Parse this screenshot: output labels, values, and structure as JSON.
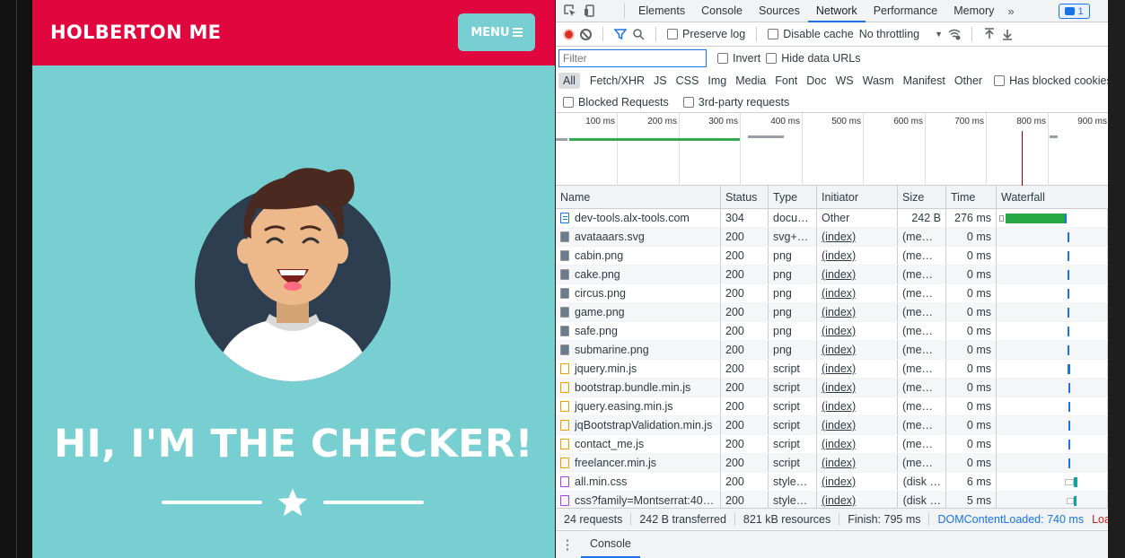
{
  "site": {
    "brand": "HOLBERTON ME",
    "menu_label": "MENU",
    "hero_title": "HI, I'M THE CHECKER!",
    "colors": {
      "nav": "#e2063f",
      "hero_bg": "#78cfd1",
      "text": "#ffffff"
    }
  },
  "devtools": {
    "tabs": [
      "Elements",
      "Console",
      "Sources",
      "Network",
      "Performance",
      "Memory"
    ],
    "active_tab": "Network",
    "more_tabs": "»",
    "issues_count": "1",
    "toolbar": {
      "preserve_log": "Preserve log",
      "disable_cache": "Disable cache",
      "throttling": "No throttling"
    },
    "filter": {
      "placeholder": "Filter",
      "invert": "Invert",
      "hide_data_urls": "Hide data URLs"
    },
    "types": [
      "All",
      "Fetch/XHR",
      "JS",
      "CSS",
      "Img",
      "Media",
      "Font",
      "Doc",
      "WS",
      "Wasm",
      "Manifest",
      "Other"
    ],
    "has_blocked_cookies": "Has blocked cookies",
    "blocked_requests": "Blocked Requests",
    "third_party": "3rd-party requests",
    "overview_ticks": [
      "100 ms",
      "200 ms",
      "300 ms",
      "400 ms",
      "500 ms",
      "600 ms",
      "700 ms",
      "800 ms",
      "900 ms"
    ],
    "columns": [
      "Name",
      "Status",
      "Type",
      "Initiator",
      "Size",
      "Time",
      "Waterfall"
    ],
    "requests": [
      {
        "icon": "doc",
        "name": "dev-tools.alx-tools.com",
        "status": "304",
        "type": "docu…",
        "initiator": "Other",
        "size": "242 B",
        "time": "276 ms"
      },
      {
        "icon": "img",
        "name": "avataaars.svg",
        "status": "200",
        "type": "svg+xml",
        "initiator": "(index)",
        "size": "(mem…",
        "time": "0 ms"
      },
      {
        "icon": "img",
        "name": "cabin.png",
        "status": "200",
        "type": "png",
        "initiator": "(index)",
        "size": "(mem…",
        "time": "0 ms"
      },
      {
        "icon": "img",
        "name": "cake.png",
        "status": "200",
        "type": "png",
        "initiator": "(index)",
        "size": "(mem…",
        "time": "0 ms"
      },
      {
        "icon": "img",
        "name": "circus.png",
        "status": "200",
        "type": "png",
        "initiator": "(index)",
        "size": "(mem…",
        "time": "0 ms"
      },
      {
        "icon": "img",
        "name": "game.png",
        "status": "200",
        "type": "png",
        "initiator": "(index)",
        "size": "(mem…",
        "time": "0 ms"
      },
      {
        "icon": "img",
        "name": "safe.png",
        "status": "200",
        "type": "png",
        "initiator": "(index)",
        "size": "(mem…",
        "time": "0 ms"
      },
      {
        "icon": "img",
        "name": "submarine.png",
        "status": "200",
        "type": "png",
        "initiator": "(index)",
        "size": "(mem…",
        "time": "0 ms"
      },
      {
        "icon": "js",
        "name": "jquery.min.js",
        "status": "200",
        "type": "script",
        "initiator": "(index)",
        "size": "(mem…",
        "time": "0 ms"
      },
      {
        "icon": "js",
        "name": "bootstrap.bundle.min.js",
        "status": "200",
        "type": "script",
        "initiator": "(index)",
        "size": "(mem…",
        "time": "0 ms"
      },
      {
        "icon": "js",
        "name": "jquery.easing.min.js",
        "status": "200",
        "type": "script",
        "initiator": "(index)",
        "size": "(mem…",
        "time": "0 ms"
      },
      {
        "icon": "js",
        "name": "jqBootstrapValidation.min.js",
        "status": "200",
        "type": "script",
        "initiator": "(index)",
        "size": "(mem…",
        "time": "0 ms"
      },
      {
        "icon": "js",
        "name": "contact_me.js",
        "status": "200",
        "type": "script",
        "initiator": "(index)",
        "size": "(mem…",
        "time": "0 ms"
      },
      {
        "icon": "js",
        "name": "freelancer.min.js",
        "status": "200",
        "type": "script",
        "initiator": "(index)",
        "size": "(mem…",
        "time": "0 ms"
      },
      {
        "icon": "css",
        "name": "all.min.css",
        "status": "200",
        "type": "styles…",
        "initiator": "(index)",
        "size": "(disk …",
        "time": "6 ms"
      },
      {
        "icon": "css",
        "name": "css?family=Montserrat:40…",
        "status": "200",
        "type": "styles…",
        "initiator": "(index)",
        "size": "(disk …",
        "time": "5 ms"
      }
    ],
    "summary": {
      "requests": "24 requests",
      "transferred": "242 B transferred",
      "resources": "821 kB resources",
      "finish": "Finish: 795 ms",
      "dcl": "DOMContentLoaded: 740 ms",
      "load": "Load"
    },
    "drawer_tab": "Console"
  }
}
